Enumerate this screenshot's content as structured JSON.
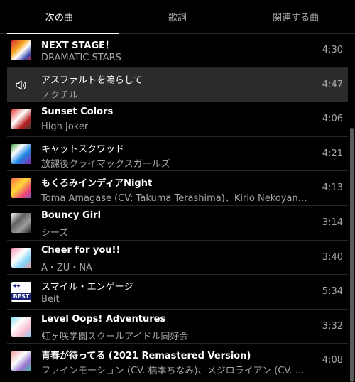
{
  "tabs": [
    {
      "label": "次の曲",
      "active": true
    },
    {
      "label": "歌詞",
      "active": false
    },
    {
      "label": "関連する曲",
      "active": false
    }
  ],
  "queue": [
    {
      "title": "NEXT STAGE！",
      "artist": "DRAMATIC STARS",
      "duration": "4:30",
      "art": "album-art"
    },
    {
      "title": "アスファルトを鳴らして",
      "artist": "ノクチル",
      "duration": "4:47",
      "art": "speaker-icon",
      "now_playing": true
    },
    {
      "title": "Sunset Colors",
      "artist": "High Joker",
      "duration": "4:06",
      "art": "album-art"
    },
    {
      "title": "キャットスクワッド",
      "artist": "放課後クライマックスガールズ",
      "duration": "4:21",
      "art": "album-art"
    },
    {
      "title": "もくろみインディアNight",
      "artist": "Toma Amagase (CV: Takuma Terashima)、Kirio Nekoyanagi ...",
      "duration": "4:13",
      "art": "album-art"
    },
    {
      "title": "Bouncy Girl",
      "artist": "シーズ",
      "duration": "3:14",
      "art": "album-art"
    },
    {
      "title": "Cheer for you!!",
      "artist": "A・ZU・NA",
      "duration": "3:40",
      "art": "album-art"
    },
    {
      "title": "スマイル・エンゲージ",
      "artist": "Beit",
      "duration": "5:34",
      "art": "album-art",
      "art_text": "BEST"
    },
    {
      "title": "Level Oops! Adventures",
      "artist": "虹ヶ咲学園スクールアイドル同好会",
      "duration": "3:32",
      "art": "album-art"
    },
    {
      "title": "青春が待ってる (2021 Remastered Version)",
      "artist": "ファインモーション (CV. 橋本ちなみ)、メジロライアン (CV. ...",
      "duration": "4:08",
      "art": "album-art"
    }
  ],
  "colors": {
    "background": "#000000",
    "now_playing_row": "#2b2b2b",
    "secondary_text": "#a5a5a5"
  }
}
